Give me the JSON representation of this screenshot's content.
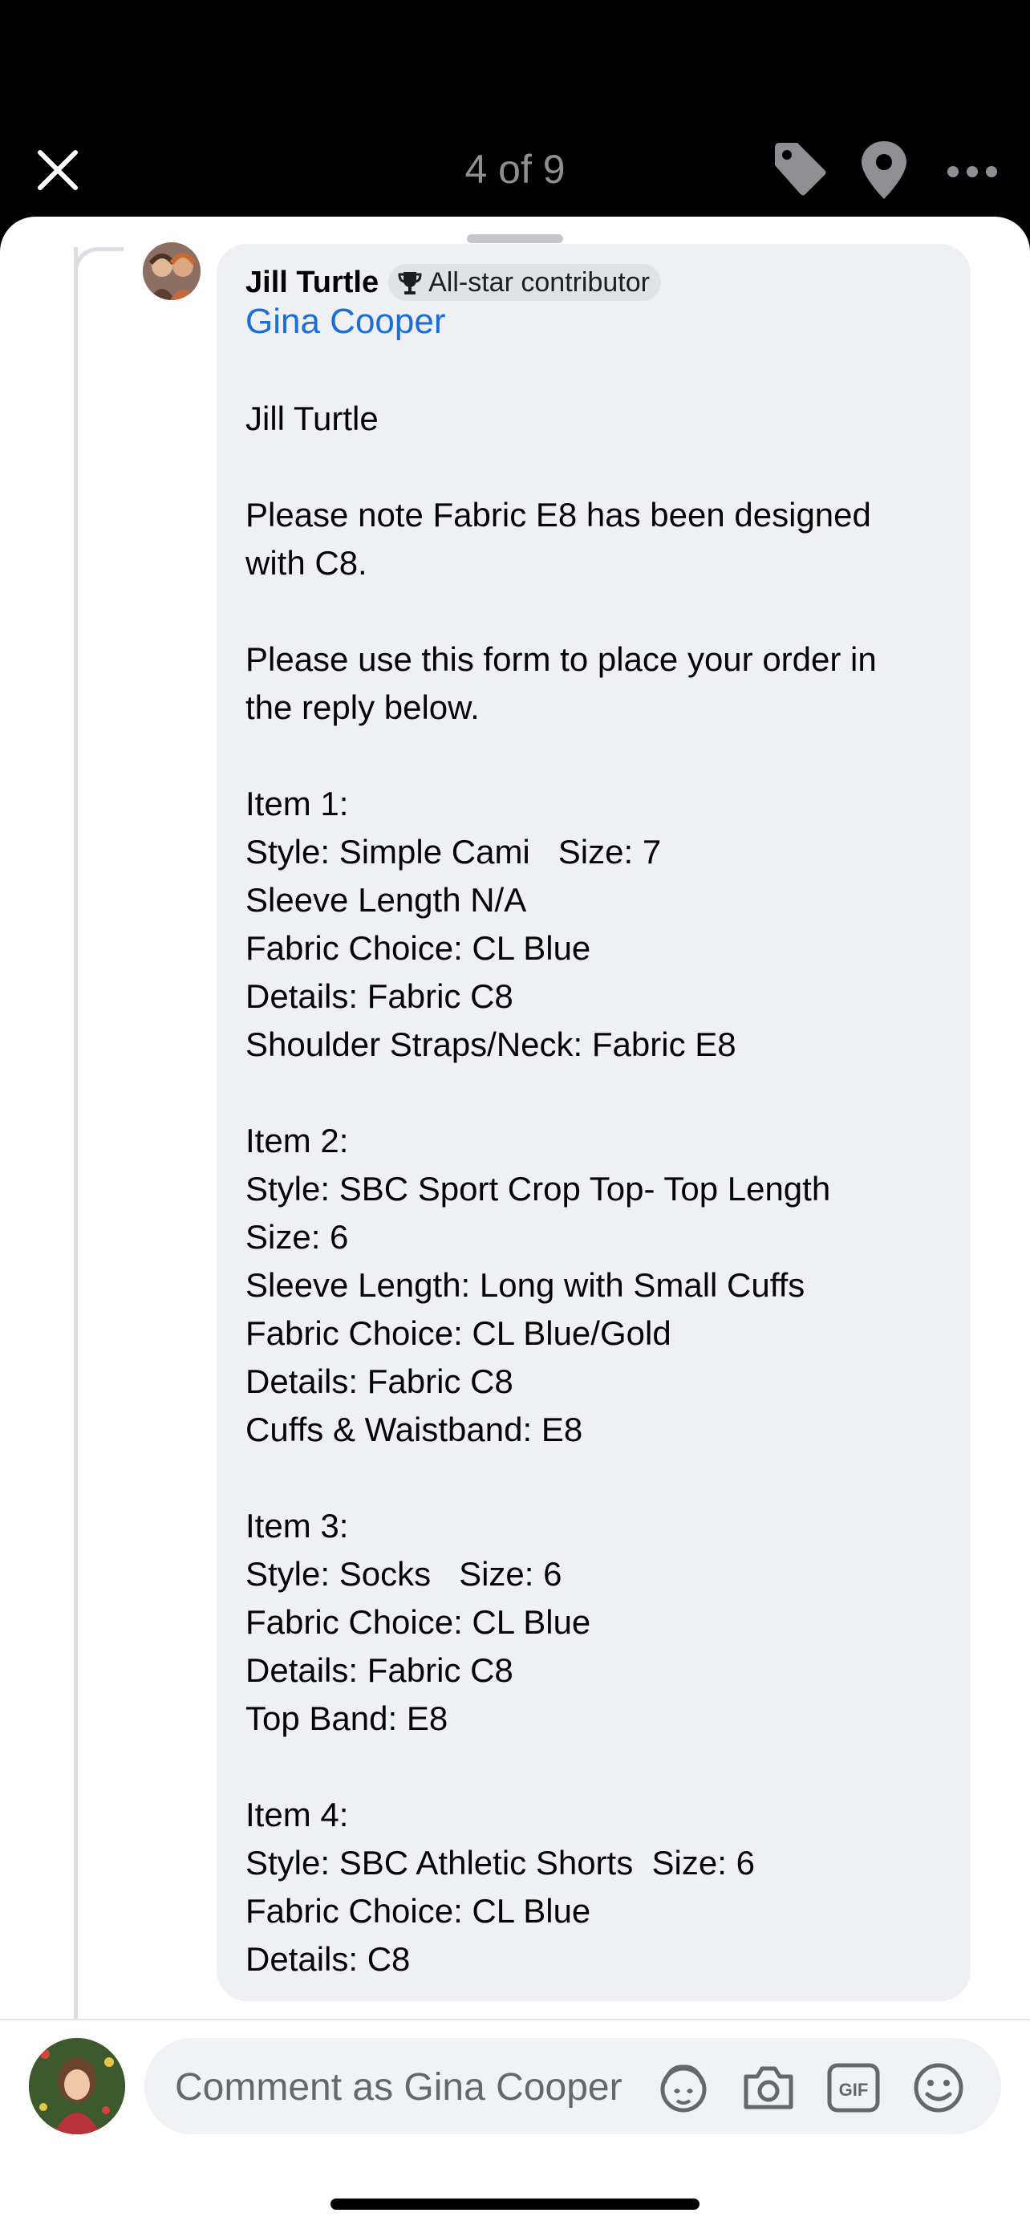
{
  "header": {
    "counter": "4 of 9",
    "icons": [
      "close-icon",
      "tag-icon",
      "location-pin-icon",
      "more-icon"
    ]
  },
  "comment": {
    "author": "Jill Turtle",
    "badge": "All-star contributor",
    "badge_icon": "trophy-icon",
    "mention": "Gina Cooper",
    "lines": [
      "Jill Turtle",
      "",
      "Please note Fabric E8 has been designed",
      "with C8.",
      "",
      "Please use this form to place your order in",
      "the reply below.",
      "",
      "Item 1:",
      "Style: Simple Cami   Size: 7",
      "Sleeve Length N/A",
      "Fabric Choice: CL Blue",
      "Details: Fabric C8",
      "Shoulder Straps/Neck: Fabric E8",
      "",
      "Item 2:",
      "Style: SBC Sport Crop Top- Top Length",
      "Size: 6",
      "Sleeve Length: Long with Small Cuffs",
      "Fabric Choice: CL Blue/Gold",
      "Details: Fabric C8",
      "Cuffs & Waistband: E8",
      "",
      "Item 3:",
      "Style: Socks   Size: 6",
      "Fabric Choice: CL Blue",
      "Details: Fabric C8",
      "Top Band: E8",
      "",
      "Item 4:",
      "Style: SBC Athletic Shorts  Size: 6",
      "Fabric Choice: CL Blue",
      "Details: C8"
    ]
  },
  "composer": {
    "placeholder": "Comment as Gina Cooper",
    "icons": [
      "avatar-sticker-icon",
      "camera-icon",
      "gif-icon",
      "emoji-icon"
    ]
  },
  "colors": {
    "mention": "#1a6ed8",
    "bubble": "#eef0f3",
    "top_bar": "#000000"
  }
}
